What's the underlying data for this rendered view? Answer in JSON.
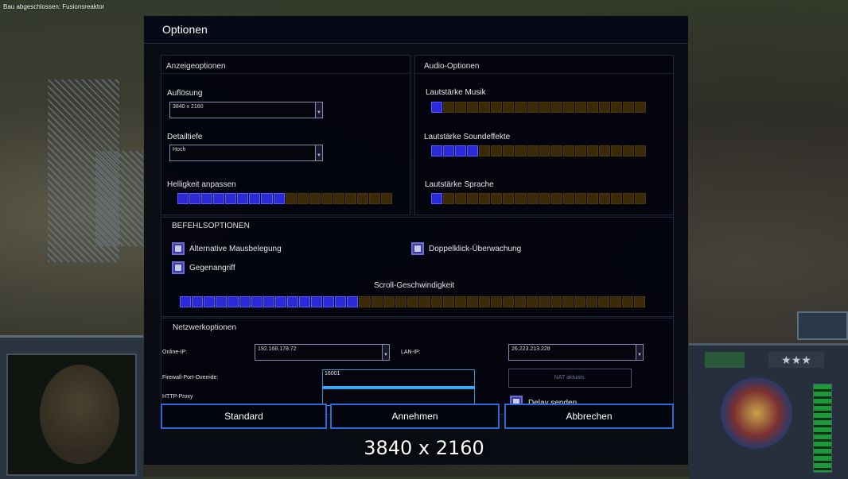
{
  "hud": {
    "top_left": "Bau abgeschlossen: Fusionsreaktor"
  },
  "dialog": {
    "title": "Optionen"
  },
  "display": {
    "section_title": "Anzeigeoptionen",
    "resolution_label": "Auflösung",
    "resolution_value": "3840 x 2160",
    "detail_label": "Detailtiefe",
    "detail_value": "Hoch",
    "brightness_label": "Helligkeit anpassen",
    "brightness_level": 0.5
  },
  "audio": {
    "section_title": "Audio-Optionen",
    "music_label": "Lautstärke Musik",
    "music_level": 0.05,
    "sfx_label": "Lautstärke Soundeffekte",
    "sfx_level": 0.2,
    "voice_label": "Lautstärke Sprache",
    "voice_level": 0.05
  },
  "command": {
    "section_title": "BEFEHLSOPTIONEN",
    "alt_mouse_label": "Alternative Mausbelegung",
    "double_click_label": "Doppelklick-Überwachung",
    "counterattack_label": "Gegenangriff",
    "scroll_label": "Scroll-Geschwindigkeit",
    "scroll_level": 0.38
  },
  "network": {
    "section_title": "Netzwerkoptionen",
    "online_ip_label": "Online-IP:",
    "online_ip_value": "192.168.178.72",
    "lan_ip_label": "LAN-IP:",
    "lan_ip_value": "26.223.213.228",
    "firewall_label": "Firewall-Port-Override:",
    "firewall_value": "16001",
    "proxy_label": "HTTP-Proxy",
    "proxy_value": "",
    "nat_button": "NAT aktuals.",
    "delay_label": "Delay senden"
  },
  "buttons": {
    "standard": "Standard",
    "accept": "Annehmen",
    "cancel": "Abbrechen"
  },
  "caption": "3840 x 2160",
  "colors": {
    "slider_on": "#2a2ad8",
    "slider_off": "#3a2a08",
    "button_border": "#2a6ad8"
  }
}
